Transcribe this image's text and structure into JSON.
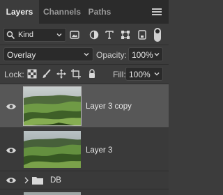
{
  "tabs": {
    "layers": "Layers",
    "channels": "Channels",
    "paths": "Paths"
  },
  "filter": {
    "kind_label": "Kind"
  },
  "blend": {
    "mode": "Overlay",
    "opacity_label": "Opacity:",
    "opacity_value": "100%"
  },
  "lock": {
    "label": "Lock:",
    "fill_label": "Fill:",
    "fill_value": "100%"
  },
  "layers": [
    {
      "name": "Layer 3 copy",
      "visible": true,
      "selected": true,
      "type": "image"
    },
    {
      "name": "Layer 3",
      "visible": true,
      "selected": false,
      "type": "image"
    },
    {
      "name": "DB",
      "visible": true,
      "selected": false,
      "type": "group"
    }
  ],
  "icons": {
    "search": "search-icon",
    "filter_pixel": "image-icon",
    "filter_adjustment": "adjustment-icon",
    "filter_type": "type-icon",
    "filter_shape": "shape-icon",
    "filter_smart": "smart-object-icon",
    "lock_transparent": "checkerboard-icon",
    "lock_image": "brush-icon",
    "lock_position": "move-icon",
    "lock_artboard": "artboard-icon",
    "lock_all": "lock-icon",
    "visibility": "eye-icon",
    "folder": "folder-icon"
  },
  "colors": {
    "panel": "#3c3c3c",
    "tabbar": "#2b2b2b",
    "selected_row": "#575757",
    "field": "#2a2a2a"
  }
}
